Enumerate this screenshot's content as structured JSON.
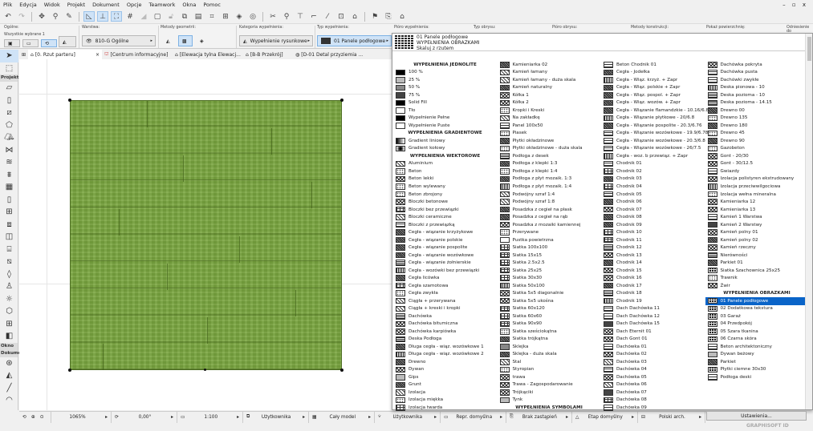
{
  "menu": [
    "Plik",
    "Edycja",
    "Widok",
    "Projekt",
    "Dokument",
    "Opcje",
    "Teamwork",
    "Okna",
    "Pomoc"
  ],
  "window_controls": "– ▫ x",
  "infobox": {
    "general_label": "Ogólne:",
    "selected_label": "Wszystkie wybrane 1",
    "layer_label": "Warstwa:",
    "layer_value": "810-G Ogólne",
    "geometry_label": "Metody geometrii:",
    "fill_category_label": "Kategoria wypełnienia:",
    "fill_category_value": "Wypełnienie rysunkowe",
    "fill_type_label": "Typ wypełnienia:",
    "fill_type_value": "01 Panele podłogowe",
    "fill_pen_label": "Pióro wypełnienia:",
    "outline_type_label": "Typ obrysu:",
    "outline_pen_label": "Pióro obrysu:",
    "construction_label": "Metody konstrukcji:",
    "show_area_label": "Pokaż powierzchnię:",
    "reference_label": "Odniesienie do"
  },
  "tabs": [
    "[0. Rzut parteru]",
    "[Centrum informacyjne]",
    "[Elewacja tylna Elewacj...",
    "[B-B Przekrój]",
    "[D-01 Detal przyziemia ..."
  ],
  "toolbox": {
    "sections": [
      "Projekt",
      "Okno",
      "Dokume"
    ]
  },
  "status": {
    "zoom": "1065%",
    "angle": "0,00°",
    "scale": "1:100",
    "layer_combo": "Użytkownika",
    "model": "Cały model",
    "pen_set": "Użytkownika",
    "model_view": "Repr. domyślna",
    "override": "Brak zastąpień",
    "phase": "Etap domyślny",
    "dimension": "Polski arch."
  },
  "dropdown": {
    "preview_name": "01 Panele podłogowe",
    "preview_category": "WYPEŁNIENIA OBRAZKAMI",
    "preview_option": "Skaluj z rzutem",
    "selected": "01 Panele podłogowe",
    "selected_color": "#0a64c8",
    "columns": [
      [
        {
          "h": "WYPEŁNIENIA JEDNOLITE"
        },
        {
          "l": "100 %",
          "s": "solid"
        },
        {
          "l": "25 %",
          "s": "g25"
        },
        {
          "l": "50 %",
          "s": "g50"
        },
        {
          "l": "75 %",
          "s": "g75"
        },
        {
          "l": "Solid Fill",
          "s": "solid"
        },
        {
          "l": "Tło",
          "s": "white"
        },
        {
          "l": "Wypełnienie Pełne",
          "s": "solid"
        },
        {
          "l": "Wypełnienie Puste",
          "s": "white"
        },
        {
          "h": "WYPEŁNIENIA GRADIENTOWE"
        },
        {
          "l": "Gradient liniowy",
          "s": "grad"
        },
        {
          "l": "Gradient kołowy",
          "s": "radial"
        },
        {
          "h": "WYPEŁNIENIA WEKTOROWE"
        },
        {
          "l": "Aluminium",
          "s": "diag"
        },
        {
          "l": "Beton",
          "s": "dots"
        },
        {
          "l": "Beton lekki",
          "s": "cross"
        },
        {
          "l": "Beton wylewany",
          "s": "dots"
        },
        {
          "l": "Beton zbrojony",
          "s": "dots"
        },
        {
          "l": "Bloczki betonowe",
          "s": "cross"
        },
        {
          "l": "Bloczki bez przewiązki",
          "s": "grid"
        },
        {
          "l": "Bloczki ceramiczne",
          "s": "diag"
        },
        {
          "l": "Bloczki z przewiązką",
          "s": "brick"
        },
        {
          "l": "Cegła - wiązanie krzyżykowe",
          "s": "dense"
        },
        {
          "l": "Cegła - wiązanie polskie",
          "s": "dense"
        },
        {
          "l": "Cegła - wiązanie pospolite",
          "s": "dense"
        },
        {
          "l": "Cegła - wiązanie wozówkowe",
          "s": "dense"
        },
        {
          "l": "Cegła - wiązanie żołnierskie",
          "s": "hlines"
        },
        {
          "l": "Cegła - wozówki bez przewiązki",
          "s": "vlines"
        },
        {
          "l": "Cegła licówka",
          "s": "dense"
        },
        {
          "l": "Cegła szamotowa",
          "s": "grid"
        },
        {
          "l": "Cegła zwykła",
          "s": "dots"
        },
        {
          "l": "Ciągła + przerywana",
          "s": "diag"
        },
        {
          "l": "Ciągła + kreski i kropki",
          "s": "diag"
        },
        {
          "l": "Dachówka",
          "s": "hlines"
        },
        {
          "l": "Dachówka bitumiczna",
          "s": "cross"
        },
        {
          "l": "Dachówka karpiówka",
          "s": "cross"
        },
        {
          "l": "Deska Podłoga",
          "s": "hlines"
        },
        {
          "l": "Długa cegła - wiąz. wozówkowe 1",
          "s": "dense"
        },
        {
          "l": "Długa cegła - wiąz. wozówkowe 2",
          "s": "vlines"
        },
        {
          "l": "Drewno",
          "s": "dense"
        },
        {
          "l": "Dywan",
          "s": "cross"
        },
        {
          "l": "Gips",
          "s": "g25"
        },
        {
          "l": "Grunt",
          "s": "dense"
        },
        {
          "l": "Izolacja",
          "s": "diag"
        },
        {
          "l": "Izolacja miękka",
          "s": "dots"
        },
        {
          "l": "Izolacja twarda",
          "s": "grid"
        }
      ],
      [
        {
          "l": "Kamieniarka 02",
          "s": "dense"
        },
        {
          "l": "Kamień łamany",
          "s": "diag"
        },
        {
          "l": "Kamień łamany - duża skala",
          "s": "diag"
        },
        {
          "l": "Kamień naturalny",
          "s": "dense"
        },
        {
          "l": "Kółka 1",
          "s": "cross"
        },
        {
          "l": "Kółka 2",
          "s": "cross"
        },
        {
          "l": "Kropki i Kreski",
          "s": "dots"
        },
        {
          "l": "Na zakładkę",
          "s": "diag"
        },
        {
          "l": "Panel 100x50",
          "s": "brick"
        },
        {
          "l": "Piasek",
          "s": "dots"
        },
        {
          "l": "Płytki okładzinowe",
          "s": "dense"
        },
        {
          "l": "Płytki okładzinowe - duża skala",
          "s": "dots"
        },
        {
          "l": "Podłoga z desek",
          "s": "hlines"
        },
        {
          "l": "Podłoga z klepki 1:3",
          "s": "dense"
        },
        {
          "l": "Podłoga z klepki 1:4",
          "s": "dots"
        },
        {
          "l": "Podłoga z płyt mozaik. 1:3",
          "s": "dense"
        },
        {
          "l": "Podłoga z płyt mozaik. 1:4",
          "s": "vlines"
        },
        {
          "l": "Podwójny szraf 1:4",
          "s": "diag"
        },
        {
          "l": "Podwójny szraf 1:8",
          "s": "diag"
        },
        {
          "l": "Posadzka z cegieł na płask",
          "s": "dense"
        },
        {
          "l": "Posadzka z cegieł na rąb",
          "s": "dense"
        },
        {
          "l": "Posadzka z mozaiki kamiennej",
          "s": "cross"
        },
        {
          "l": "Przerywane",
          "s": "dots"
        },
        {
          "l": "Pustka powietrzna",
          "s": "white"
        },
        {
          "l": "Siatka 100x100",
          "s": "grid"
        },
        {
          "l": "Siatka 15x15",
          "s": "grid"
        },
        {
          "l": "Siatka 2.5x2.5",
          "s": "grid"
        },
        {
          "l": "Siatka 25x25",
          "s": "grid"
        },
        {
          "l": "Siatka 30x30",
          "s": "grid"
        },
        {
          "l": "Siatka 50x100",
          "s": "vlines"
        },
        {
          "l": "Siatka 5x5 diagonalnie",
          "s": "cross"
        },
        {
          "l": "Siatka 5x5 ukośna",
          "s": "cross"
        },
        {
          "l": "Siatka 60x120",
          "s": "grid"
        },
        {
          "l": "Siatka 60x60",
          "s": "grid"
        },
        {
          "l": "Siatka 90x90",
          "s": "grid"
        },
        {
          "l": "Siatka sześciokątna",
          "s": "dots"
        },
        {
          "l": "Siatka trójkątna",
          "s": "dense"
        },
        {
          "l": "Sklejka",
          "s": "g50"
        },
        {
          "l": "Sklejka - duża skala",
          "s": "dense"
        },
        {
          "l": "Stal",
          "s": "diag"
        },
        {
          "l": "Styropian",
          "s": "dots"
        },
        {
          "l": "trawa",
          "s": "cross"
        },
        {
          "l": "Trawa - Zagospodarowanie",
          "s": "cross"
        },
        {
          "l": "Trójkąciki",
          "s": "cross"
        },
        {
          "l": "Tynk",
          "s": "g25"
        },
        {
          "h": "WYPEŁNIENIA SYMBOLAMI"
        }
      ],
      [
        {
          "l": "Beton Chodnik 01",
          "s": "brick"
        },
        {
          "l": "Cegła - Jodełka",
          "s": "dense"
        },
        {
          "l": "Cegła - Wiąz. krzyż. + Zapr",
          "s": "vlines"
        },
        {
          "l": "Cegła - Wiąz. polskie + Zapr",
          "s": "dense"
        },
        {
          "l": "Cegła - Wiąz. pospol. + Zapr",
          "s": "dense"
        },
        {
          "l": "Cegła - Wiąz. wozów. + Zapr",
          "s": "dense"
        },
        {
          "l": "Cegła - Wiązanie flamandzkie - 10.16/6.8",
          "s": "dense"
        },
        {
          "l": "Cegła - Wiązanie płytkowe - 20/6.8",
          "s": "vlines"
        },
        {
          "l": "Cegła - Wiązanie pospolite - 20.3/6.76",
          "s": "dense"
        },
        {
          "l": "Cegła - Wiązanie wozówkowe - 19.9/6.78",
          "s": "brick"
        },
        {
          "l": "Cegła - Wiązanie wozówkowe - 20.3/6.8",
          "s": "brick"
        },
        {
          "l": "Cegła - Wiązanie wozówkowe - 26/7.5",
          "s": "brick"
        },
        {
          "l": "Cegła - woz. b przewiąz. + Zapr",
          "s": "vlines"
        },
        {
          "l": "Chodnik 01",
          "s": "brick"
        },
        {
          "l": "Chodnik 02",
          "s": "grid"
        },
        {
          "l": "Chodnik 03",
          "s": "dense"
        },
        {
          "l": "Chodnik 04",
          "s": "grid"
        },
        {
          "l": "Chodnik 05",
          "s": "brick"
        },
        {
          "l": "Chodnik 06",
          "s": "dense"
        },
        {
          "l": "Chodnik 07",
          "s": "cross"
        },
        {
          "l": "Chodnik 08",
          "s": "dense"
        },
        {
          "l": "Chodnik 09",
          "s": "dense"
        },
        {
          "l": "Chodnik 10",
          "s": "grid"
        },
        {
          "l": "Chodnik 11",
          "s": "grid"
        },
        {
          "l": "Chodnik 12",
          "s": "hlines"
        },
        {
          "l": "Chodnik 13",
          "s": "cross"
        },
        {
          "l": "Chodnik 14",
          "s": "dense"
        },
        {
          "l": "Chodnik 15",
          "s": "cross"
        },
        {
          "l": "Chodnik 16",
          "s": "cross"
        },
        {
          "l": "Chodnik 17",
          "s": "dense"
        },
        {
          "l": "Chodnik 18",
          "s": "hlines"
        },
        {
          "l": "Chodnik 19",
          "s": "vlines"
        },
        {
          "l": "Dach Dachówka 11",
          "s": "brick"
        },
        {
          "l": "Dach Dachówka 12",
          "s": "brick"
        },
        {
          "l": "Dach Dachówka 15",
          "s": "g75"
        },
        {
          "l": "Dach Eternit 01",
          "s": "cross"
        },
        {
          "l": "Dach Gont 01",
          "s": "cross"
        },
        {
          "l": "Dachówka 01",
          "s": "brick"
        },
        {
          "l": "Dachówka 02",
          "s": "cross"
        },
        {
          "l": "Dachówka 03",
          "s": "diag"
        },
        {
          "l": "Dachówka 04",
          "s": "brick"
        },
        {
          "l": "Dachówka 05",
          "s": "cross"
        },
        {
          "l": "Dachówka 06",
          "s": "diag"
        },
        {
          "l": "Dachówka 07",
          "s": "g75"
        },
        {
          "l": "Dachówka 08",
          "s": "grid"
        },
        {
          "l": "Dachówka 09",
          "s": "brick"
        }
      ],
      [
        {
          "l": "Dachówka pokryta",
          "s": "cross"
        },
        {
          "l": "Dachówka pusta",
          "s": "brick"
        },
        {
          "l": "Dachówki zwykłe",
          "s": "brick"
        },
        {
          "l": "Deska pionowa - 10",
          "s": "vlines"
        },
        {
          "l": "Deska pozioma - 10",
          "s": "hlines"
        },
        {
          "l": "Deska pozioma - 14.15",
          "s": "hlines"
        },
        {
          "l": "Drewno 00",
          "s": "dense"
        },
        {
          "l": "Drewno 135",
          "s": "dots"
        },
        {
          "l": "Drewno 180",
          "s": "dense"
        },
        {
          "l": "Drewno 45",
          "s": "dots"
        },
        {
          "l": "Drewno 90",
          "s": "dense"
        },
        {
          "l": "Gazobeton",
          "s": "dots"
        },
        {
          "l": "Gont - 20/30",
          "s": "cross"
        },
        {
          "l": "Gont - 30/12.5",
          "s": "cross"
        },
        {
          "l": "Gwiazdy",
          "s": "brick"
        },
        {
          "l": "Izolacja polistyren ekstrudowany",
          "s": "cross"
        },
        {
          "l": "Izolacja przeciwwilgociowa",
          "s": "vlines"
        },
        {
          "l": "Izolacja wełna mineralna",
          "s": "dots"
        },
        {
          "l": "Kamieniarka 12",
          "s": "cross"
        },
        {
          "l": "Kamieniarka 13",
          "s": "cross"
        },
        {
          "l": "Kamień 1 Warstwa",
          "s": "brick"
        },
        {
          "l": "Kamień 2 Warstwy",
          "s": "g75"
        },
        {
          "l": "Kamień polny 01",
          "s": "cross"
        },
        {
          "l": "Kamień polny 02",
          "s": "dense"
        },
        {
          "l": "Kamień rzeczny",
          "s": "cross"
        },
        {
          "l": "Nierówności",
          "s": "hlines"
        },
        {
          "l": "Parkiet 01",
          "s": "dense"
        },
        {
          "l": "Siatka Szachownica 25x25",
          "s": "pic"
        },
        {
          "l": "Trawnik",
          "s": "dots"
        },
        {
          "l": "Żwir",
          "s": "cross"
        },
        {
          "h": "WYPEŁNIENIA OBRAZKAMI"
        },
        {
          "l": "01 Panele podłogowe",
          "s": "pic"
        },
        {
          "l": "02 Dodatkowa tekstura",
          "s": "pic"
        },
        {
          "l": "03 Garaż",
          "s": "pic"
        },
        {
          "l": "04 Przedpokój",
          "s": "pic"
        },
        {
          "l": "05 Szara tkanina",
          "s": "pic"
        },
        {
          "l": "06 Czarna skóra",
          "s": "pic"
        },
        {
          "l": "Beton architektoniczny",
          "s": "brick"
        },
        {
          "l": "Dywan beżowy",
          "s": "g25"
        },
        {
          "l": "Parkiet",
          "s": "dense"
        },
        {
          "l": "Płytki ciemne 30x30",
          "s": "pic"
        },
        {
          "l": "Podłoga deski",
          "s": "brick"
        }
      ]
    ]
  },
  "settings_button": "Ustawienia...",
  "brand": "GRAPHISOFT ID",
  "fill_color": "#7aa640"
}
